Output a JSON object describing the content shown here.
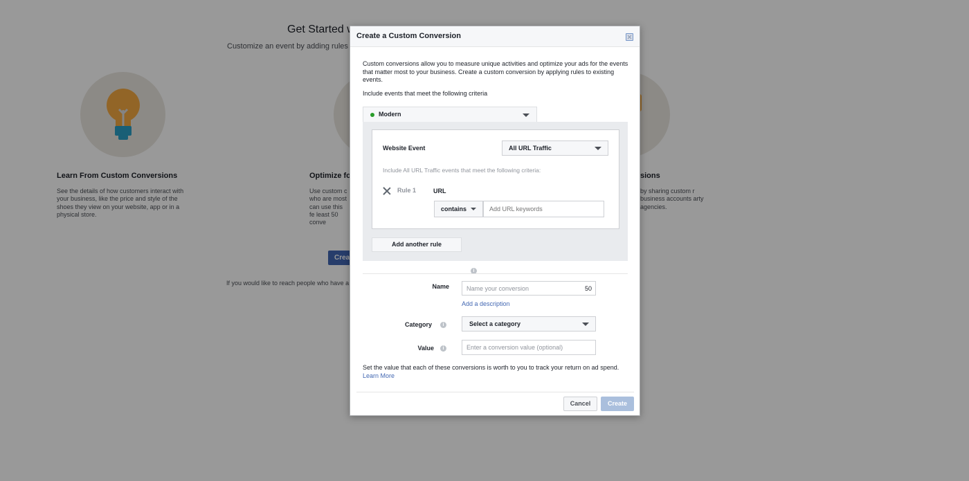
{
  "background": {
    "title": "Get Started w",
    "subtitle": "Customize an event by adding rules a",
    "features": [
      {
        "title": "Learn From Custom Conversions",
        "description": "See the details of how customers interact with your business, like the price and style of the shoes they view on your website, app or in a physical store.",
        "icon": "lightbulb-icon"
      },
      {
        "title": "Optimize fo",
        "description": "Use custom c who are most can use this fe least 50 conve",
        "icon": "optimize-icon"
      },
      {
        "title": "sions",
        "description": "by sharing custom r business accounts arty agencies.",
        "icon": "share-icon"
      }
    ],
    "create_button": "Crea",
    "footer_text": "If you would like to reach people who have a"
  },
  "modal": {
    "title": "Create a Custom Conversion",
    "close_icon": "close-icon",
    "intro": "Custom conversions allow you to measure unique activities and optimize your ads for the events that matter most to your business. Create a custom conversion by applying rules to existing events.",
    "criteria_label": "Include events that meet the following criteria",
    "source": {
      "value": "Modern",
      "status_color": "#2a9c2a"
    },
    "rule_builder": {
      "event_label": "Website Event",
      "event_value": "All URL Traffic",
      "include_text": "Include All URL Traffic events that meet the following criteria:",
      "rules": [
        {
          "label": "Rule 1",
          "field": "URL",
          "operator": "contains",
          "input_value": "",
          "input_placeholder": "Add URL keywords"
        }
      ],
      "add_rule_label": "Add another rule"
    },
    "form": {
      "name_label": "Name",
      "name_placeholder": "Name your conversion",
      "name_value": "",
      "name_char_count": "50",
      "add_description": "Add a description",
      "category_label": "Category",
      "category_value": "Select a category",
      "value_label": "Value",
      "value_placeholder": "Enter a conversion value (optional)",
      "value_value": "",
      "help_text": "Set the value that each of these conversions is worth to you to track your return on ad spend.",
      "learn_more": "Learn More"
    },
    "footer": {
      "cancel_label": "Cancel",
      "create_label": "Create"
    }
  },
  "colors": {
    "link": "#4267b2",
    "primary_button": "#4267b2",
    "disabled_primary": "#9cb4d8"
  }
}
